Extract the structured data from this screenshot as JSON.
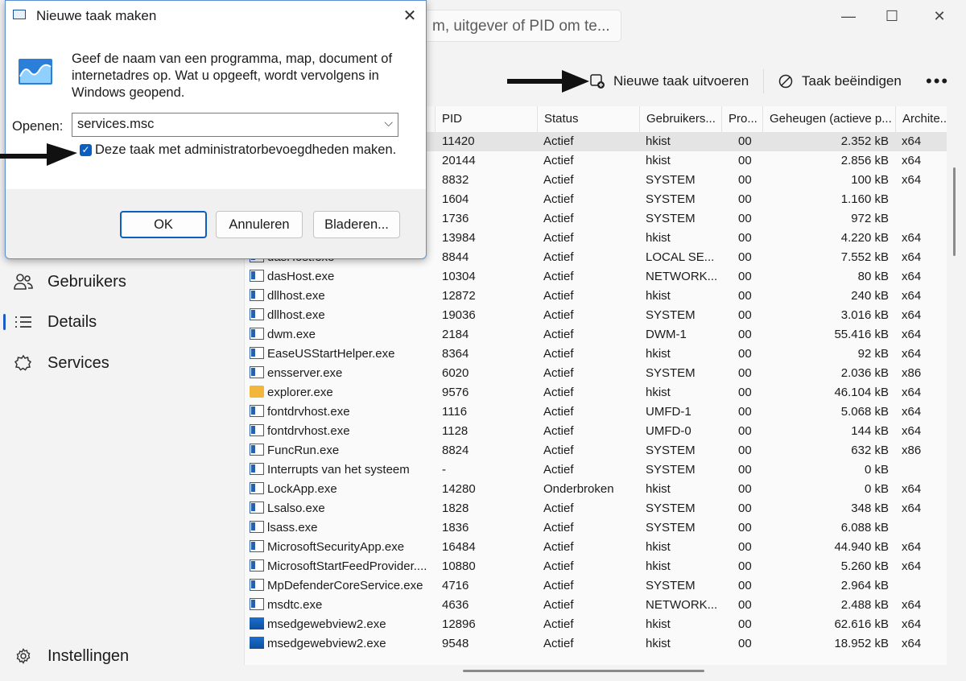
{
  "search": {
    "placeholder": "m, uitgever of PID om te..."
  },
  "toolbar": {
    "run_task_label": "Nieuwe taak uitvoeren",
    "end_task_label": "Taak beëindigen",
    "more_label": "•••"
  },
  "sidebar": {
    "users": "Gebruikers",
    "details": "Details",
    "services": "Services",
    "settings": "Instellingen"
  },
  "table": {
    "columns": [
      "PID",
      "Status",
      "Gebruikers...",
      "Pro...",
      "Geheugen (actieve p...",
      "Archite..."
    ],
    "rows": [
      {
        "name": "",
        "pid": "11420",
        "status": "Actief",
        "user": "hkist",
        "prio": "00",
        "mem": "2.352 kB",
        "arch": "x64",
        "icon": "app-icon"
      },
      {
        "name": "",
        "pid": "20144",
        "status": "Actief",
        "user": "hkist",
        "prio": "00",
        "mem": "2.856 kB",
        "arch": "x64",
        "icon": "app-icon"
      },
      {
        "name": "",
        "pid": "8832",
        "status": "Actief",
        "user": "SYSTEM",
        "prio": "00",
        "mem": "100 kB",
        "arch": "x64",
        "icon": "app-icon"
      },
      {
        "name": "",
        "pid": "1604",
        "status": "Actief",
        "user": "SYSTEM",
        "prio": "00",
        "mem": "1.160 kB",
        "arch": "",
        "icon": "app-icon"
      },
      {
        "name": "",
        "pid": "1736",
        "status": "Actief",
        "user": "SYSTEM",
        "prio": "00",
        "mem": "972 kB",
        "arch": "",
        "icon": "app-icon"
      },
      {
        "name": "",
        "pid": "13984",
        "status": "Actief",
        "user": "hkist",
        "prio": "00",
        "mem": "4.220 kB",
        "arch": "x64",
        "icon": "app-icon"
      },
      {
        "name": "dasHost.exe",
        "pid": "8844",
        "status": "Actief",
        "user": "LOCAL SE...",
        "prio": "00",
        "mem": "7.552 kB",
        "arch": "x64",
        "icon": "app-icon"
      },
      {
        "name": "dasHost.exe",
        "pid": "10304",
        "status": "Actief",
        "user": "NETWORK...",
        "prio": "00",
        "mem": "80 kB",
        "arch": "x64",
        "icon": "app-icon"
      },
      {
        "name": "dllhost.exe",
        "pid": "12872",
        "status": "Actief",
        "user": "hkist",
        "prio": "00",
        "mem": "240 kB",
        "arch": "x64",
        "icon": "app-icon"
      },
      {
        "name": "dllhost.exe",
        "pid": "19036",
        "status": "Actief",
        "user": "SYSTEM",
        "prio": "00",
        "mem": "3.016 kB",
        "arch": "x64",
        "icon": "app-icon"
      },
      {
        "name": "dwm.exe",
        "pid": "2184",
        "status": "Actief",
        "user": "DWM-1",
        "prio": "00",
        "mem": "55.416 kB",
        "arch": "x64",
        "icon": "app-icon"
      },
      {
        "name": "EaseUSStartHelper.exe",
        "pid": "8364",
        "status": "Actief",
        "user": "hkist",
        "prio": "00",
        "mem": "92 kB",
        "arch": "x64",
        "icon": "app-icon"
      },
      {
        "name": "ensserver.exe",
        "pid": "6020",
        "status": "Actief",
        "user": "SYSTEM",
        "prio": "00",
        "mem": "2.036 kB",
        "arch": "x86",
        "icon": "app-icon"
      },
      {
        "name": "explorer.exe",
        "pid": "9576",
        "status": "Actief",
        "user": "hkist",
        "prio": "00",
        "mem": "46.104 kB",
        "arch": "x64",
        "icon": "folder-icon"
      },
      {
        "name": "fontdrvhost.exe",
        "pid": "1116",
        "status": "Actief",
        "user": "UMFD-1",
        "prio": "00",
        "mem": "5.068 kB",
        "arch": "x64",
        "icon": "app-icon"
      },
      {
        "name": "fontdrvhost.exe",
        "pid": "1128",
        "status": "Actief",
        "user": "UMFD-0",
        "prio": "00",
        "mem": "144 kB",
        "arch": "x64",
        "icon": "app-icon"
      },
      {
        "name": "FuncRun.exe",
        "pid": "8824",
        "status": "Actief",
        "user": "SYSTEM",
        "prio": "00",
        "mem": "632 kB",
        "arch": "x86",
        "icon": "app-icon"
      },
      {
        "name": "Interrupts van het systeem",
        "pid": "-",
        "status": "Actief",
        "user": "SYSTEM",
        "prio": "00",
        "mem": "0 kB",
        "arch": "",
        "icon": "app-icon"
      },
      {
        "name": "LockApp.exe",
        "pid": "14280",
        "status": "Onderbroken",
        "user": "hkist",
        "prio": "00",
        "mem": "0 kB",
        "arch": "x64",
        "icon": "app-icon"
      },
      {
        "name": "Lsalso.exe",
        "pid": "1828",
        "status": "Actief",
        "user": "SYSTEM",
        "prio": "00",
        "mem": "348 kB",
        "arch": "x64",
        "icon": "app-icon"
      },
      {
        "name": "lsass.exe",
        "pid": "1836",
        "status": "Actief",
        "user": "SYSTEM",
        "prio": "00",
        "mem": "6.088 kB",
        "arch": "",
        "icon": "app-icon"
      },
      {
        "name": "MicrosoftSecurityApp.exe",
        "pid": "16484",
        "status": "Actief",
        "user": "hkist",
        "prio": "00",
        "mem": "44.940 kB",
        "arch": "x64",
        "icon": "app-icon"
      },
      {
        "name": "MicrosoftStartFeedProvider....",
        "pid": "10880",
        "status": "Actief",
        "user": "hkist",
        "prio": "00",
        "mem": "5.260 kB",
        "arch": "x64",
        "icon": "app-icon"
      },
      {
        "name": "MpDefenderCoreService.exe",
        "pid": "4716",
        "status": "Actief",
        "user": "SYSTEM",
        "prio": "00",
        "mem": "2.964 kB",
        "arch": "",
        "icon": "app-icon"
      },
      {
        "name": "msdtc.exe",
        "pid": "4636",
        "status": "Actief",
        "user": "NETWORK...",
        "prio": "00",
        "mem": "2.488 kB",
        "arch": "x64",
        "icon": "app-icon"
      },
      {
        "name": "msedgewebview2.exe",
        "pid": "12896",
        "status": "Actief",
        "user": "hkist",
        "prio": "00",
        "mem": "62.616 kB",
        "arch": "x64",
        "icon": "edge-icon"
      },
      {
        "name": "msedgewebview2.exe",
        "pid": "9548",
        "status": "Actief",
        "user": "hkist",
        "prio": "00",
        "mem": "18.952 kB",
        "arch": "x64",
        "icon": "edge-icon"
      }
    ]
  },
  "dialog": {
    "title": "Nieuwe taak maken",
    "description": "Geef de naam van een programma, map, document of internetadres op. Wat u opgeeft, wordt vervolgens in Windows geopend.",
    "open_label": "Openen:",
    "input_value": "services.msc",
    "admin_checkbox_label": "Deze taak met administratorbevoegdheden maken.",
    "admin_checked": true,
    "ok_label": "OK",
    "cancel_label": "Annuleren",
    "browse_label": "Bladeren..."
  },
  "colors": {
    "accent": "#0a5fc0",
    "selection": "#e4e4e4"
  }
}
